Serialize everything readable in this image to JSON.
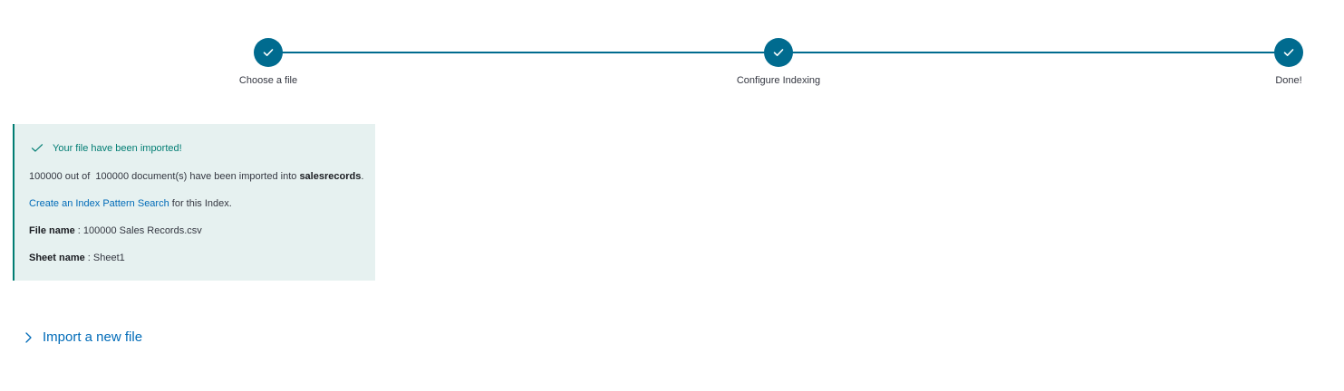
{
  "steps": [
    {
      "label": "Choose a file",
      "status": "complete"
    },
    {
      "label": "Configure Indexing",
      "status": "complete"
    },
    {
      "label": "Done!",
      "status": "complete"
    }
  ],
  "callout": {
    "title": "Your file have been imported!",
    "count_prefix": "100000 out of  100000 document(s) have been imported into ",
    "index_name": "salesrecords",
    "count_suffix": ".",
    "link_text": "Create an Index Pattern Search",
    "link_suffix": " for this Index.",
    "file_label": "File name",
    "file_sep": " : ",
    "file_value": "100000 Sales Records.csv",
    "sheet_label": "Sheet name",
    "sheet_sep": " : ",
    "sheet_value": "Sheet1"
  },
  "accordion": {
    "label": "Import a new file"
  },
  "colors": {
    "step_accent": "#006b8f",
    "success": "#017d73",
    "success_bg": "#e6f1f0",
    "link": "#006bb8"
  },
  "icons": {
    "step": "check-icon",
    "callout": "check-icon",
    "accordion": "chevron-right-icon"
  }
}
